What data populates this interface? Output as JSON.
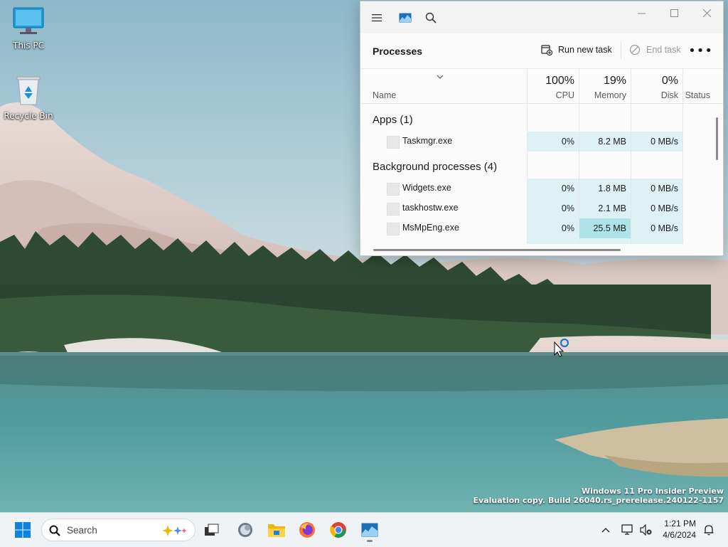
{
  "desktop": {
    "icons": [
      {
        "label": "This PC"
      },
      {
        "label": "Recycle Bin"
      }
    ],
    "watermark": {
      "line1": "Windows 11 Pro Insider Preview",
      "line2": "Evaluation copy. Build 26040.rs_prerelease.240122-1157"
    }
  },
  "task_manager": {
    "page_title": "Processes",
    "run_new_task": "Run new task",
    "end_task": "End task",
    "columns": {
      "name": "Name",
      "cpu": {
        "pct": "100%",
        "label": "CPU"
      },
      "memory": {
        "pct": "19%",
        "label": "Memory"
      },
      "disk": {
        "pct": "0%",
        "label": "Disk"
      },
      "status": "Status"
    },
    "groups": {
      "apps": "Apps (1)",
      "background": "Background processes (4)"
    },
    "rows": [
      {
        "name": "Taskmgr.exe",
        "cpu": "0%",
        "memory": "8.2 MB",
        "disk": "0 MB/s"
      },
      {
        "name": "Widgets.exe",
        "cpu": "0%",
        "memory": "1.8 MB",
        "disk": "0 MB/s"
      },
      {
        "name": "taskhostw.exe",
        "cpu": "0%",
        "memory": "2.1 MB",
        "disk": "0 MB/s"
      },
      {
        "name": "MsMpEng.exe",
        "cpu": "0%",
        "memory": "25.5 MB",
        "disk": "0 MB/s"
      }
    ]
  },
  "taskbar": {
    "search_placeholder": "Search",
    "time": "1:21 PM",
    "date": "4/6/2024"
  },
  "colors": {
    "accent": "#0067c0",
    "heat_light": "#def2f6",
    "heat_mid": "#aee3ea"
  }
}
